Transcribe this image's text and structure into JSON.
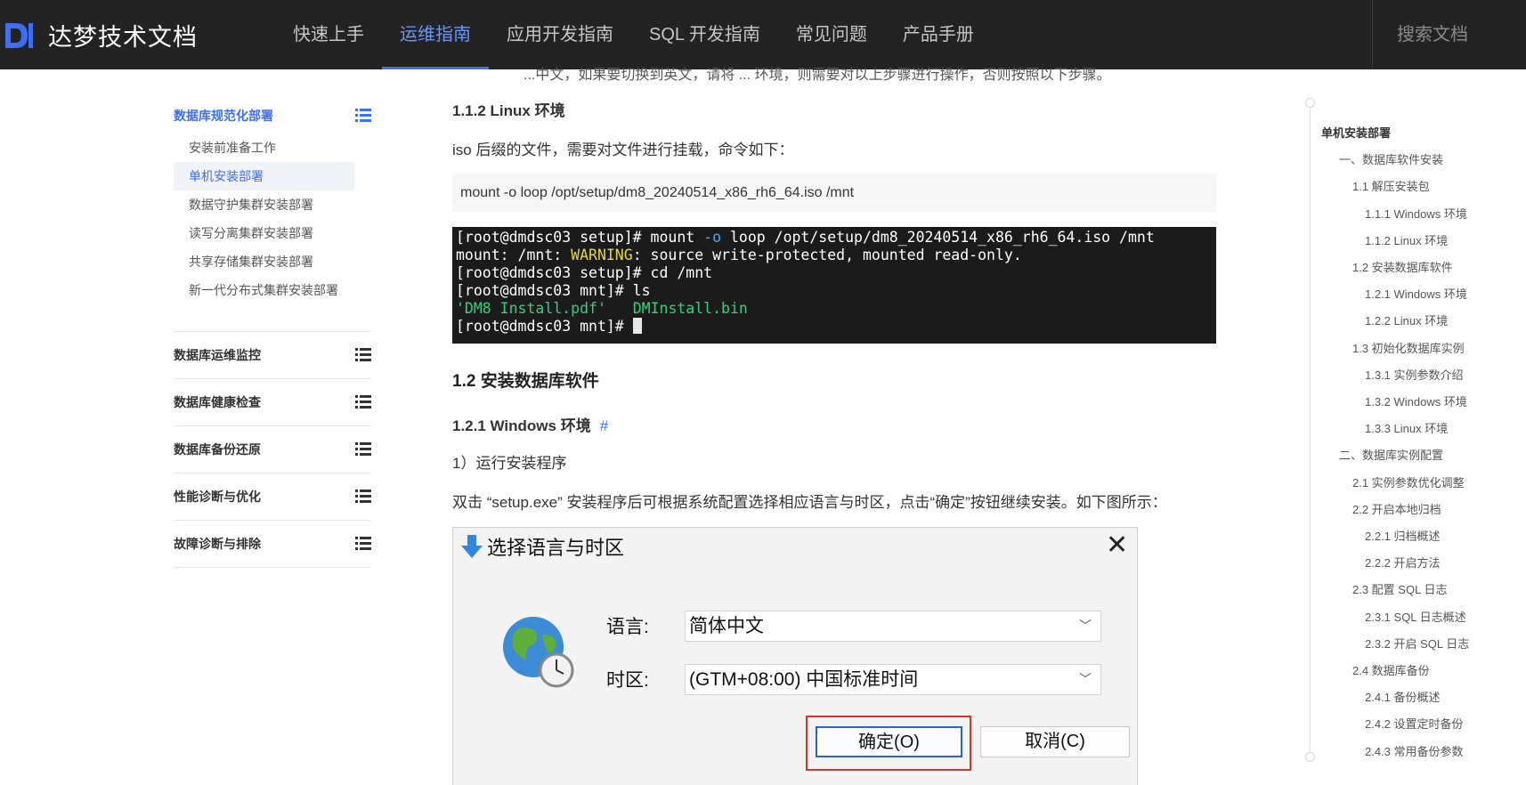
{
  "header": {
    "brand_title": "达梦技术文档",
    "nav": [
      {
        "label": "快速上手",
        "active": false
      },
      {
        "label": "运维指南",
        "active": true
      },
      {
        "label": "应用开发指南",
        "active": false
      },
      {
        "label": "SQL 开发指南",
        "active": false
      },
      {
        "label": "常见问题",
        "active": false
      },
      {
        "label": "产品手册",
        "active": false
      }
    ],
    "search_placeholder": "搜索文档"
  },
  "sidebar": {
    "active_group": "数据库规范化部署",
    "sub_items": [
      "安装前准备工作",
      "单机安装部署",
      "数据守护集群安装部署",
      "读写分离集群安装部署",
      "共享存储集群安装部署",
      "新一代分布式集群安装部署"
    ],
    "active_sub": "单机安装部署",
    "groups": [
      "数据库运维监控",
      "数据库健康检查",
      "数据库备份还原",
      "性能诊断与优化",
      "故障诊断与排除"
    ]
  },
  "content": {
    "cut_text": "...中文，如果要切换到英文，请将 ... 环境，则需要对以上步骤进行操作，否则按照以下步骤。",
    "h_linux": "1.1.2 Linux 环境",
    "p_iso": "iso 后缀的文件，需要对文件进行挂载，命令如下：",
    "code_mount": "mount -o loop /opt/setup/dm8_20240514_x86_rh6_64.iso /mnt",
    "terminal": {
      "l1_prompt": "[root@dmdsc03 setup]# mount ",
      "l1_flag": "-o",
      "l1_rest": " loop /opt/setup/dm8_20240514_x86_rh6_64.iso /mnt",
      "l2_pre": "mount: /mnt: ",
      "l2_warn": "WARNING",
      "l2_rest": ": source write-protected, mounted read-only.",
      "l3": "[root@dmdsc03 setup]# cd /mnt",
      "l4": "[root@dmdsc03 mnt]# ls",
      "l5_a": "'DM8 Install.pdf'",
      "l5_gap": "   ",
      "l5_b": "DMInstall.bin",
      "l6": "[root@dmdsc03 mnt]# "
    },
    "h_install": "1.2 安装数据库软件",
    "h_windows": "1.2.1 Windows 环境",
    "anchor": "#",
    "p_step": "1）运行安装程序",
    "p_desc": "双击 “setup.exe” 安装程序后可根据系统配置选择相应语言与时区，点击“确定”按钮继续安装。如下图所示：",
    "dialog": {
      "title": "选择语言与时区",
      "close": "✕",
      "lang_label": "语言:",
      "lang_value": "简体中文",
      "tz_label": "时区:",
      "tz_value": "(GTM+08:00) 中国标准时间",
      "ok": "确定(O)",
      "cancel": "取消(C)"
    }
  },
  "toc": {
    "items": [
      {
        "label": "单机安装部署",
        "level": 0
      },
      {
        "label": "一、数据库软件安装",
        "level": 1
      },
      {
        "label": "1.1 解压安装包",
        "level": 2
      },
      {
        "label": "1.1.1 Windows 环境",
        "level": 3
      },
      {
        "label": "1.1.2 Linux 环境",
        "level": 3
      },
      {
        "label": "1.2 安装数据库软件",
        "level": 2
      },
      {
        "label": "1.2.1 Windows 环境",
        "level": 3
      },
      {
        "label": "1.2.2 Linux 环境",
        "level": 3
      },
      {
        "label": "1.3 初始化数据库实例",
        "level": 2
      },
      {
        "label": "1.3.1 实例参数介绍",
        "level": 3
      },
      {
        "label": "1.3.2 Windows 环境",
        "level": 3
      },
      {
        "label": "1.3.3 Linux 环境",
        "level": 3
      },
      {
        "label": "二、数据库实例配置",
        "level": 1
      },
      {
        "label": "2.1 实例参数优化调整",
        "level": 2
      },
      {
        "label": "2.2 开启本地归档",
        "level": 2
      },
      {
        "label": "2.2.1 归档概述",
        "level": 3
      },
      {
        "label": "2.2.2 开启方法",
        "level": 3
      },
      {
        "label": "2.3 配置 SQL 日志",
        "level": 2
      },
      {
        "label": "2.3.1 SQL 日志概述",
        "level": 3
      },
      {
        "label": "2.3.2 开启 SQL 日志",
        "level": 3
      },
      {
        "label": "2.4 数据库备份",
        "level": 2
      },
      {
        "label": "2.4.1 备份概述",
        "level": 3
      },
      {
        "label": "2.4.2 设置定时备份",
        "level": 3
      },
      {
        "label": "2.4.3 常用备份参数",
        "level": 3
      }
    ]
  },
  "colors": {
    "accent": "#3e6ef2",
    "topbar": "#232323",
    "terminal_bg": "#1b1b1b",
    "highlight_red": "#e0302a"
  }
}
